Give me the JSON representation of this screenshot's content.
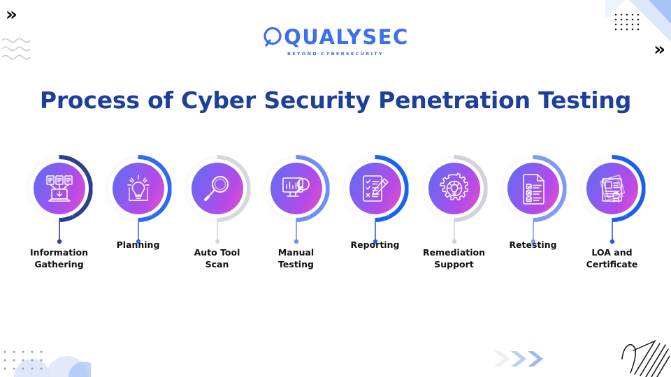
{
  "brand": {
    "logo_text": "QUALYSEC",
    "tagline": "BEYOND CYBERSECURITY",
    "logo_color": "#3a6ff0"
  },
  "header": {
    "title": "Process of Cyber Security Penetration Testing",
    "title_color": "#1c3f9b"
  },
  "background_color": "#ffffff",
  "steps": [
    {
      "index": "1",
      "label": "Information\nGathering",
      "icon": "documents-to-laptop-download-icon",
      "ring_color": "#2f3f8c",
      "label_offset": "normal"
    },
    {
      "index": "2",
      "label": "Planning",
      "icon": "lightbulb-board-icon",
      "ring_color": "#2f6af0",
      "label_offset": "raised"
    },
    {
      "index": "3",
      "label": "Auto Tool\nScan",
      "icon": "magnifier-icon",
      "ring_color": "#d6d8dd",
      "label_offset": "normal"
    },
    {
      "index": "4",
      "label": "Manual\nTesting",
      "icon": "monitor-chart-magnifier-icon",
      "ring_color": "#6f8ef5",
      "label_offset": "normal"
    },
    {
      "index": "5",
      "label": "Reporting",
      "icon": "checklist-pencil-icon",
      "ring_color": "#1a62f0",
      "label_offset": "raised"
    },
    {
      "index": "6",
      "label": "Remediation\nSupport",
      "icon": "gear-lightbulb-icon",
      "ring_color": "#cfd2d8",
      "label_offset": "normal"
    },
    {
      "index": "7",
      "label": "Retesting",
      "icon": "document-checkboxes-icon",
      "ring_color": "#7f9bf2",
      "label_offset": "raised"
    },
    {
      "index": "8",
      "label": "LOA and\nCertificate",
      "icon": "certificate-seal-icon",
      "ring_color": "#1d5fe8",
      "label_offset": "normal"
    }
  ],
  "decorations": {
    "chevron_top_left": "»",
    "chevron_top_right": "»",
    "wave_lines_top_left": "wave-lines",
    "triangles_top_right": "diagonal-triangles",
    "dot_grid_top_right": "dot-grid",
    "dot_grid_bottom_left": "dot-grid",
    "arches_bottom_left": "arch-shapes",
    "chevrons_bottom_right": "triple-chevron",
    "scribble_bottom_right": "hatched-scribble"
  }
}
